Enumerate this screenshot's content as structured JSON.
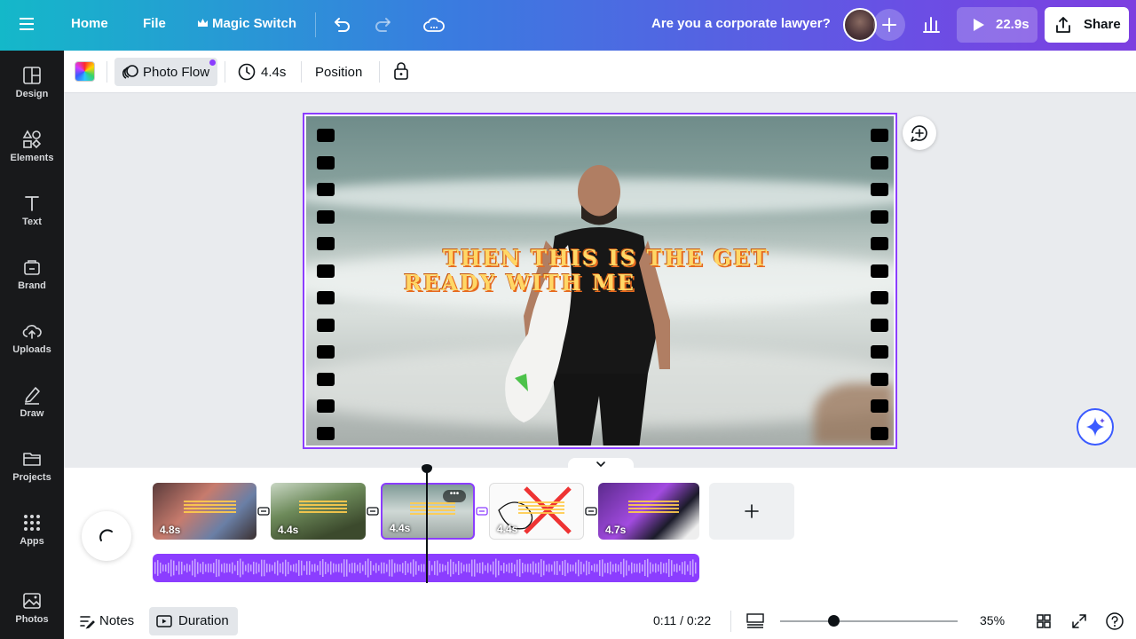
{
  "topbar": {
    "home": "Home",
    "file": "File",
    "magic_switch": "Magic Switch",
    "title": "Are you a corporate lawyer?",
    "play_duration": "22.9s",
    "share": "Share"
  },
  "sidebar": {
    "items": [
      {
        "label": "Design",
        "icon": "design-icon"
      },
      {
        "label": "Elements",
        "icon": "elements-icon"
      },
      {
        "label": "Text",
        "icon": "text-icon"
      },
      {
        "label": "Brand",
        "icon": "brand-icon"
      },
      {
        "label": "Uploads",
        "icon": "uploads-icon"
      },
      {
        "label": "Draw",
        "icon": "draw-icon"
      },
      {
        "label": "Projects",
        "icon": "projects-icon"
      },
      {
        "label": "Apps",
        "icon": "apps-icon"
      },
      {
        "label": "Photos",
        "icon": "photos-icon"
      }
    ]
  },
  "toolbar": {
    "animation": "Photo Flow",
    "duration": "4.4s",
    "position": "Position"
  },
  "canvas": {
    "headline_line1": "THEN THIS IS THE GET",
    "headline_line2": "READY WITH ME"
  },
  "timeline": {
    "clips": [
      {
        "duration": "4.8s"
      },
      {
        "duration": "4.4s"
      },
      {
        "duration": "4.4s"
      },
      {
        "duration": "4.4s"
      },
      {
        "duration": "4.7s"
      }
    ],
    "selected_clip_index": 2
  },
  "bottombar": {
    "notes": "Notes",
    "duration": "Duration",
    "time": "0:11 / 0:22",
    "zoom": "35%",
    "zoom_fraction": 0.3
  },
  "colors": {
    "accent": "#8b3dff",
    "sidebar_bg": "#18191b",
    "headline_fill": "#ffd766",
    "headline_outline": "#e66a1e"
  }
}
